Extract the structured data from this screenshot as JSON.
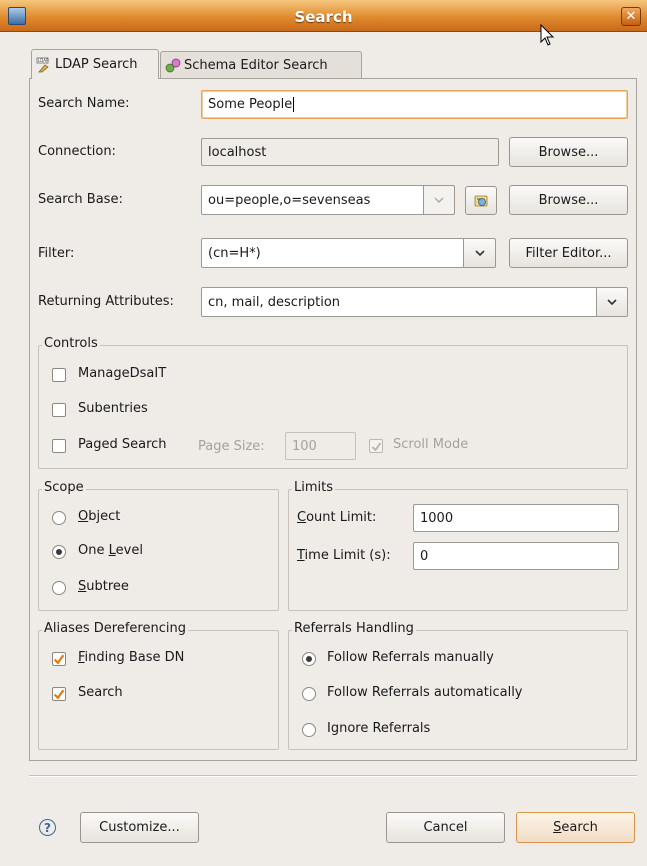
{
  "window": {
    "title": "Search",
    "close": "✕"
  },
  "tabs": [
    {
      "label": "LDAP Search",
      "active": true,
      "icon": "ldap-icon"
    },
    {
      "label": "Schema Editor Search",
      "active": false,
      "icon": "schema-icon"
    }
  ],
  "form": {
    "search_name": {
      "label": "Search Name:",
      "value": "Some People"
    },
    "connection": {
      "label": "Connection:",
      "value": "localhost",
      "browse": "Browse..."
    },
    "search_base": {
      "label": "Search Base:",
      "value": "ou=people,o=sevenseas",
      "browse": "Browse..."
    },
    "filter": {
      "label": "Filter:",
      "value": "(cn=H*)",
      "editor": "Filter Editor..."
    },
    "returning_attributes": {
      "label": "Returning Attributes:",
      "value": "cn, mail, description"
    }
  },
  "controls": {
    "title": "Controls",
    "manage_dsait": {
      "label": "ManageDsaIT",
      "checked": false
    },
    "subentries": {
      "label": "Subentries",
      "checked": false
    },
    "paged_search": {
      "label": "Paged Search",
      "checked": false
    },
    "page_size": {
      "label": "Page Size:",
      "value": "100"
    },
    "scroll_mode": {
      "label": "Scroll Mode",
      "checked": true
    }
  },
  "scope": {
    "title": "Scope",
    "options": [
      {
        "label": "Object",
        "selected": false
      },
      {
        "label": "One Level",
        "selected": true
      },
      {
        "label": "Subtree",
        "selected": false
      }
    ]
  },
  "limits": {
    "title": "Limits",
    "count": {
      "label": "Count Limit:",
      "value": "1000"
    },
    "time": {
      "label": "Time Limit (s):",
      "value": "0"
    }
  },
  "aliases": {
    "title": "Aliases Dereferencing",
    "finding_base_dn": {
      "label": "Finding Base DN",
      "checked": true
    },
    "search": {
      "label": "Search",
      "checked": true
    }
  },
  "referrals": {
    "title": "Referrals Handling",
    "options": [
      {
        "label": "Follow Referrals manually",
        "selected": true
      },
      {
        "label": "Follow Referrals automatically",
        "selected": false
      },
      {
        "label": "Ignore Referrals",
        "selected": false
      }
    ]
  },
  "footer": {
    "help": "?",
    "customize": "Customize...",
    "cancel": "Cancel",
    "search": "Search"
  },
  "colors": {
    "titlebar": "#e08a2e",
    "focus": "#e3a45a",
    "checkmark": "#e07b1a"
  }
}
